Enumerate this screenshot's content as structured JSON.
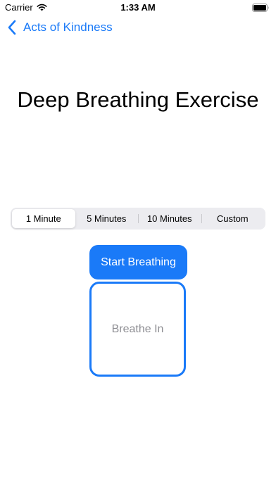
{
  "status_bar": {
    "carrier": "Carrier",
    "time": "1:33 AM"
  },
  "nav": {
    "back_label": "Acts of Kindness"
  },
  "title": "Deep Breathing Exercise",
  "duration_segments": {
    "options": [
      "1 Minute",
      "5 Minutes",
      "10 Minutes",
      "Custom"
    ],
    "selected": "1 Minute"
  },
  "start_button_label": "Start Breathing",
  "breathe_prompt": "Breathe In",
  "colors": {
    "accent": "#1a7af8",
    "prompt_text": "#8e8e93",
    "segment_bg": "#ececf0"
  },
  "icons": {
    "wifi": "wifi-icon",
    "battery": "battery-icon",
    "back": "chevron-left-icon"
  }
}
